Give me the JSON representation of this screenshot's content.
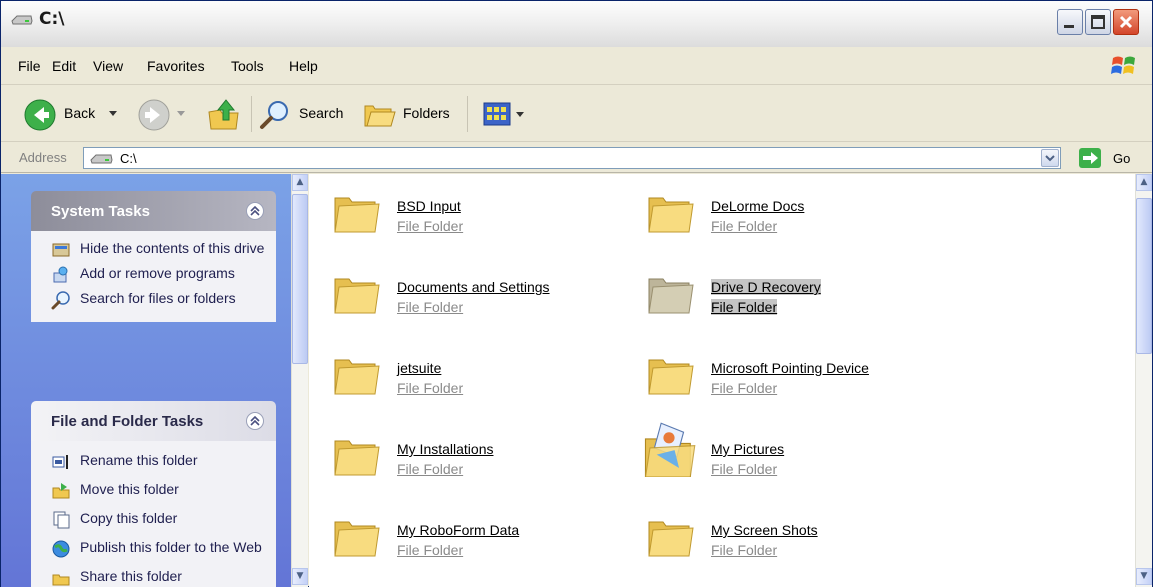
{
  "window": {
    "title": "C:\\",
    "colors": {
      "accent": "#0A246A",
      "taskpane_top": "#7BA2E7",
      "taskpane_bottom": "#6375D6",
      "folder": "#F5D67A"
    }
  },
  "menu": {
    "items": [
      "File",
      "Edit",
      "View",
      "Favorites",
      "Tools",
      "Help"
    ]
  },
  "toolbar": {
    "back_label": "Back",
    "search_label": "Search",
    "folders_label": "Folders"
  },
  "address": {
    "label": "Address",
    "value": "C:\\",
    "go_label": "Go"
  },
  "taskpane": {
    "system_tasks": {
      "title": "System Tasks",
      "items": [
        {
          "label": "Hide the contents of this drive",
          "icon": "hide-contents-icon"
        },
        {
          "label": "Add or remove programs",
          "icon": "add-remove-programs-icon"
        },
        {
          "label": "Search for files or folders",
          "icon": "search-icon"
        }
      ]
    },
    "file_folder_tasks": {
      "title": "File and Folder Tasks",
      "items": [
        {
          "label": "Rename this folder",
          "icon": "rename-icon"
        },
        {
          "label": "Move this folder",
          "icon": "move-icon"
        },
        {
          "label": "Copy this folder",
          "icon": "copy-icon"
        },
        {
          "label": "Publish this folder to the Web",
          "icon": "publish-web-icon"
        },
        {
          "label": "Share this folder",
          "icon": "share-icon"
        }
      ]
    }
  },
  "files": [
    {
      "name": "BSD Input",
      "type": "File Folder",
      "icon": "folder-icon"
    },
    {
      "name": "DeLorme Docs",
      "type": "File Folder",
      "icon": "folder-icon"
    },
    {
      "name": "Documents and Settings",
      "type": "File Folder",
      "icon": "folder-icon"
    },
    {
      "name": "Drive D Recovery",
      "type": "File Folder",
      "icon": "folder-icon",
      "selected": true
    },
    {
      "name": "jetsuite",
      "type": "File Folder",
      "icon": "folder-icon"
    },
    {
      "name": "Microsoft Pointing Device",
      "type": "File Folder",
      "icon": "folder-icon"
    },
    {
      "name": "My Installations",
      "type": "File Folder",
      "icon": "folder-icon"
    },
    {
      "name": "My Pictures",
      "type": "File Folder",
      "icon": "pictures-folder-icon"
    },
    {
      "name": "My RoboForm Data",
      "type": "File Folder",
      "icon": "folder-icon"
    },
    {
      "name": "My Screen Shots",
      "type": "File Folder",
      "icon": "folder-icon"
    }
  ]
}
